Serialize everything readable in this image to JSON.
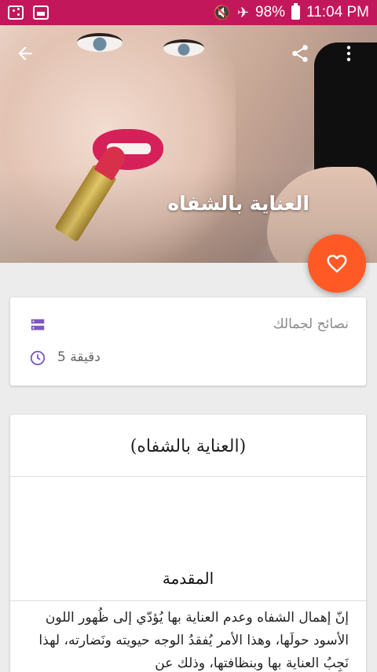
{
  "status_bar": {
    "battery": "98%",
    "time": "11:04 PM",
    "color": "#c2185b"
  },
  "header": {
    "title": "العناية بالشفاه",
    "back_icon": "arrow-left-icon",
    "share_icon": "share-icon",
    "more_icon": "more-vertical-icon",
    "favorite_icon": "heart-outline-icon",
    "fab_color": "#ff5a26"
  },
  "info": {
    "category": "نصائح لجمالك",
    "duration": "دقيقة 5",
    "accent": "#7e57c2"
  },
  "article": {
    "title": "(العناية بالشفاه)",
    "section": "المقدمة",
    "body": "إنّ إهمال الشفاه وعدم العناية بها يُؤدّي إلى ظُهور اللون الأسود حولَها، وهذا الأمر يُفقدُ الوجه حيويته ونَضارته، لهذا نَجِبُ العناية بها وبنظافتها، وذلك عن"
  }
}
